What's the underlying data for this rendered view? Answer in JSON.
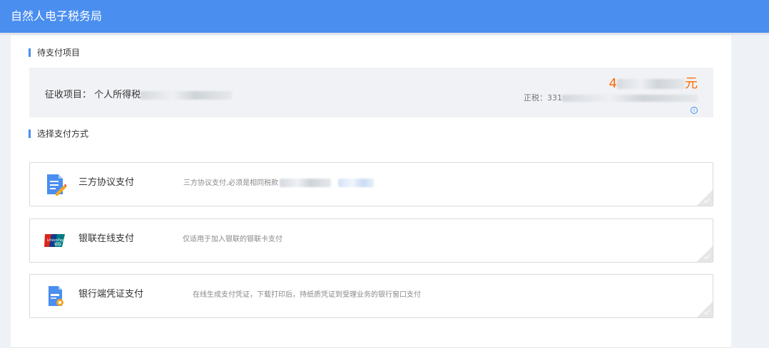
{
  "header": {
    "title": "自然人电子税务局"
  },
  "pending": {
    "section_title": "待支付项目",
    "tax_item_label": "征收项目：",
    "tax_item_value": "个人所得税",
    "amount_prefix": "4",
    "amount_suffix": "元",
    "principal_label": "正税：331",
    "info_icon": "info-circle-icon"
  },
  "payment": {
    "section_title": "选择支付方式",
    "options": [
      {
        "name": "三方协议支付",
        "desc": "三方协议支付,必须是相同税款",
        "icon": "document-edit-icon"
      },
      {
        "name": "银联在线支付",
        "desc": "仅适用于加入银联的银联卡支付",
        "icon": "unionpay-icon"
      },
      {
        "name": "银行端凭证支付",
        "desc": "在线生成支付凭证，下载打印后，持纸质凭证到受理业务的银行窗口支付",
        "icon": "voucher-icon"
      }
    ]
  },
  "colors": {
    "header": "#4a8ef0",
    "accent": "#4a8ef0",
    "amount": "#ff6a00"
  }
}
